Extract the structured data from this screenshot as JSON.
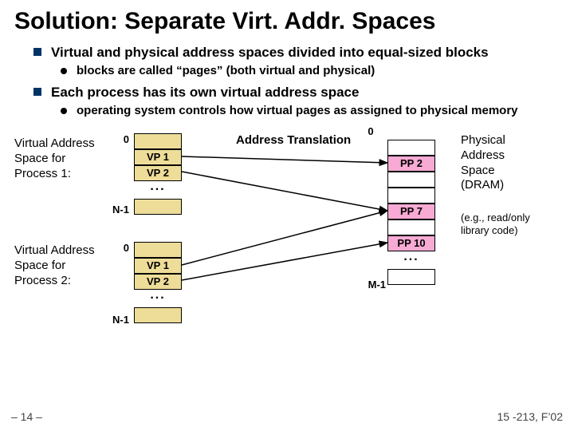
{
  "title": "Solution: Separate Virt. Addr. Spaces",
  "bullets": {
    "b1": "Virtual and physical address spaces divided into equal-sized blocks",
    "b1s1": "blocks are called “pages” (both virtual and physical)",
    "b2": "Each process has its own virtual address space",
    "b2s1": "operating system controls how virtual pages as assigned to physical memory"
  },
  "labels": {
    "vas1": "Virtual Address Space for Process 1:",
    "vas2": "Virtual Address Space for Process 2:",
    "phys": "Physical Address Space (DRAM)",
    "note": "(e.g., read/only library code)",
    "addr_trans": "Address Translation",
    "n0": "0",
    "n1": "N-1",
    "p0": "0",
    "m1": "M-1"
  },
  "vt1": {
    "r0": "",
    "r1": "VP 1",
    "r2": "VP 2"
  },
  "vt2": {
    "r0": "",
    "r1": "VP 1",
    "r2": "VP 2"
  },
  "pt": {
    "r0": "",
    "r1": "PP 2",
    "r2": "",
    "r3": "",
    "r4": "PP 7",
    "r5": "",
    "r6": "PP 10",
    "r7": ""
  },
  "footer": {
    "left": "– 14 –",
    "right": "15 -213, F’02"
  }
}
